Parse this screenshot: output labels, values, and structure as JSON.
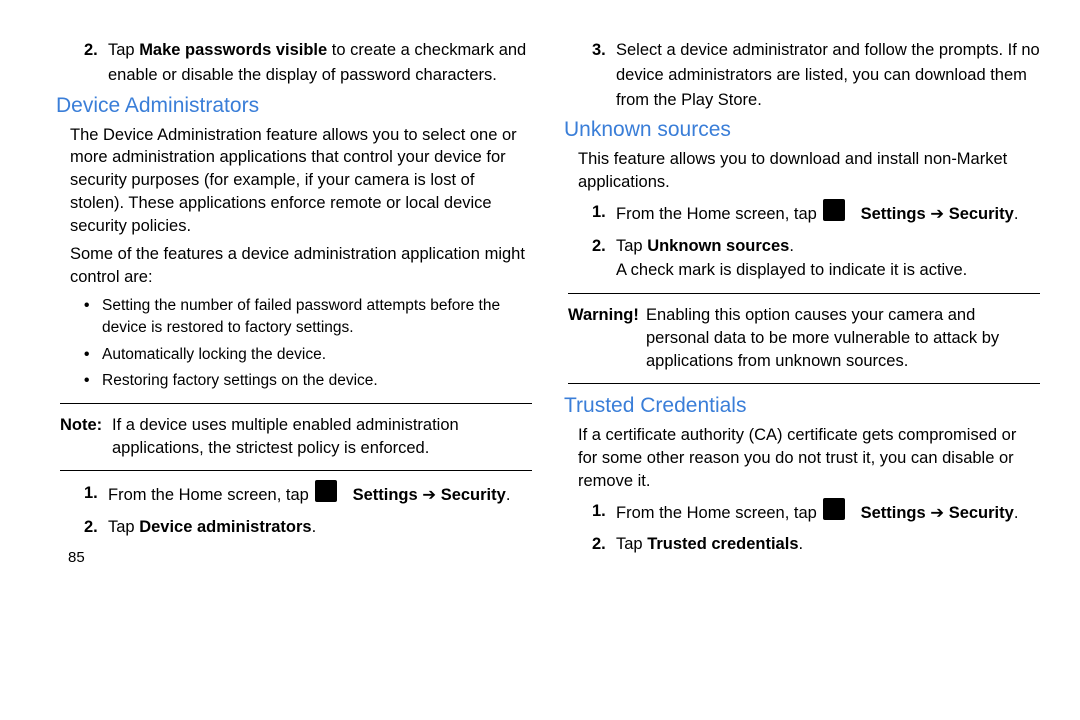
{
  "left": {
    "step2_prefix": "Tap ",
    "step2_bold": "Make passwords visible",
    "step2_suffix": " to create a checkmark and enable or disable the display of password characters.",
    "devadmin_heading": "Device Administrators",
    "devadmin_p1": "The Device Administration feature allows you to select one or more administration applications that control your device for security purposes (for example, if your camera is lost of stolen). These applications enforce remote or local device security policies.",
    "devadmin_p2": "Some of the features a device administration application might control are:",
    "bullet1": "Setting the number of failed password attempts before the device is restored to factory settings.",
    "bullet2": "Automatically locking the device.",
    "bullet3": "Restoring factory settings on the device.",
    "note_label": "Note:",
    "note_text": " If a device uses multiple enabled administration applications, the strictest policy is enforced.",
    "steps1_prefix": "From the Home screen, tap ",
    "steps1_settings": "Settings",
    "steps1_arrow": " ➔ ",
    "steps1_security": "Security",
    "period": ".",
    "steps2_prefix": "Tap ",
    "steps2_bold": "Device administrators",
    "pagenum": "85"
  },
  "right": {
    "step3": "Select a device administrator and follow the prompts. If no device administrators are listed, you can download them from the Play Store.",
    "unknown_heading": "Unknown sources",
    "unknown_p1": "This feature allows you to download and install non-Market applications.",
    "u_step1_prefix": "From the Home screen, tap ",
    "u_step1_settings": "Settings",
    "u_step1_arrow": " ➔ ",
    "u_step1_security": "Security",
    "period": ".",
    "u_step2_prefix": "Tap ",
    "u_step2_bold": "Unknown sources",
    "u_step2_after": "A check mark is displayed to indicate it is active.",
    "warn_label": "Warning!",
    "warn_text": " Enabling this option causes your camera and personal data to be more vulnerable to attack by applications from unknown sources.",
    "trusted_heading": "Trusted Credentials",
    "trusted_p1": "If a certificate authority (CA) certificate gets compromised or for some other reason you do not trust it, you can disable or remove it.",
    "t_step1_prefix": "From the Home screen, tap ",
    "t_step1_settings": "Settings",
    "t_step1_arrow": " ➔ ",
    "t_step1_security": "Security",
    "t_step2_prefix": "Tap ",
    "t_step2_bold": "Trusted credentials"
  },
  "numbers": {
    "n1": "1.",
    "n2": "2.",
    "n3": "3."
  }
}
